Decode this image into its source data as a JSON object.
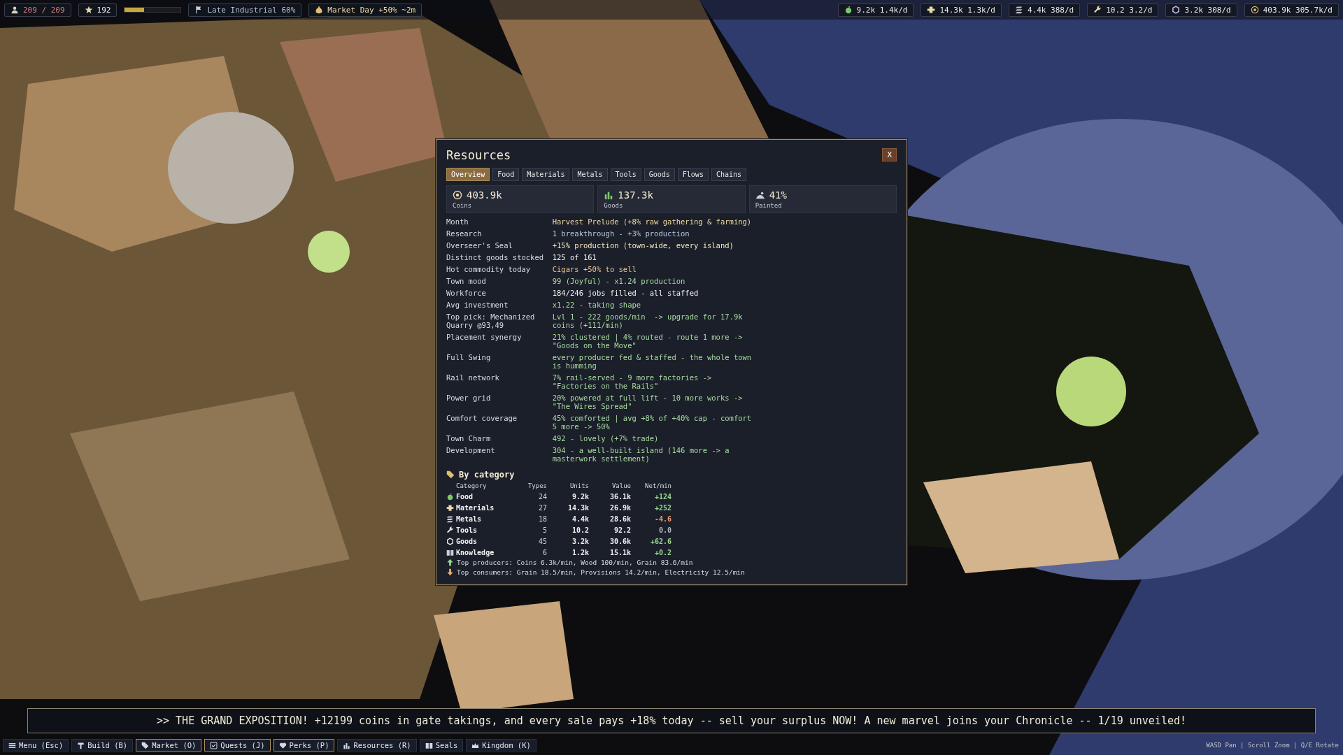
{
  "top_bar": {
    "population": "209 / 209",
    "stars": "192",
    "era_progress": {
      "level": 0.35
    },
    "era": "Late Industrial 60%",
    "event": "Market Day +50% ~2m",
    "resources": [
      {
        "text": "9.2k 1.4k/d"
      },
      {
        "text": "14.3k 1.3k/d"
      },
      {
        "text": "4.4k 388/d"
      },
      {
        "text": "10.2 3.2/d"
      },
      {
        "text": "3.2k 308/d"
      },
      {
        "text": "403.9k 305.7k/d"
      }
    ]
  },
  "panel": {
    "title": "Resources",
    "close": "X",
    "tabs": [
      {
        "label": "Overview",
        "selected": true
      },
      {
        "label": "Food",
        "selected": false
      },
      {
        "label": "Materials",
        "selected": false
      },
      {
        "label": "Metals",
        "selected": false
      },
      {
        "label": "Tools",
        "selected": false
      },
      {
        "label": "Goods",
        "selected": false
      },
      {
        "label": "Flows",
        "selected": false
      },
      {
        "label": "Chains",
        "selected": false
      }
    ],
    "stats": [
      {
        "value": "403.9k",
        "label": "Coins"
      },
      {
        "value": "137.3k",
        "label": "Goods"
      },
      {
        "value": "41%",
        "label": "Painted"
      }
    ],
    "rows": [
      {
        "label": "Month",
        "value": "Harvest Prelude (+8% raw gathering & farming)",
        "color": "#f0dca0"
      },
      {
        "label": "Research",
        "value": "1 breakthrough - +3% production",
        "color": "#b8c8e0"
      },
      {
        "label": "Overseer's Seal",
        "value": "+15% production (town-wide, every island)",
        "color": "#f4e6c0"
      },
      {
        "label": "Distinct goods stocked",
        "value": "125 of 161",
        "color": "#f4f4f4"
      },
      {
        "label": "Hot commodity today",
        "value": "Cigars +50% to sell",
        "color": "#e8c890"
      },
      {
        "label": "Town mood",
        "value": "99 (Joyful) - x1.24 production",
        "color": "#a8dca0"
      },
      {
        "label": "Workforce",
        "value": "184/246 jobs filled - all staffed",
        "color": "#f4f4f4"
      },
      {
        "label": "Avg investment",
        "value": "x1.22 - taking shape",
        "color": "#a8dca0"
      },
      {
        "label": "Top pick: Mechanized Quarry @93,49",
        "value": "Lvl 1 - 222 goods/min  -> upgrade for 17.9k coins (+111/min)",
        "color": "#a8dca0"
      },
      {
        "label": "Placement synergy",
        "value": "21% clustered | 4% routed - route 1 more -> \"Goods on the Move\"",
        "color": "#a8dca0"
      },
      {
        "label": "Full Swing",
        "value": "every producer fed & staffed - the whole town is humming",
        "color": "#a8dca0"
      },
      {
        "label": "Rail network",
        "value": "7% rail-served - 9 more factories -> \"Factories on the Rails\"",
        "color": "#a8dca0"
      },
      {
        "label": "Power grid",
        "value": "20% powered at full lift - 10 more works -> \"The Wires Spread\"",
        "color": "#a8dca0"
      },
      {
        "label": "Comfort coverage",
        "value": "45% comforted | avg +8% of +40% cap - comfort 5 more -> 50%",
        "color": "#a8dca0"
      },
      {
        "label": "Town Charm",
        "value": "492 - lovely (+7% trade)",
        "color": "#a8dca0"
      },
      {
        "label": "Development",
        "value": "304 - a well-built island (146 more -> a masterwork settlement)",
        "color": "#a8dca0"
      }
    ],
    "category_title": "By category",
    "columns": [
      "Category",
      "Types",
      "Units",
      "Value",
      "Net/min"
    ],
    "categories": [
      {
        "name": "Food",
        "types": "24",
        "units": "9.2k",
        "value": "36.1k",
        "net": "+124",
        "color": "#98d890"
      },
      {
        "name": "Materials",
        "types": "27",
        "units": "14.3k",
        "value": "26.9k",
        "net": "+252",
        "color": "#98d890"
      },
      {
        "name": "Metals",
        "types": "18",
        "units": "4.4k",
        "value": "28.6k",
        "net": "-4.6",
        "color": "#e8a070"
      },
      {
        "name": "Tools",
        "types": "5",
        "units": "10.2",
        "value": "92.2",
        "net": "0.0",
        "color": "#b0b4bc"
      },
      {
        "name": "Goods",
        "types": "45",
        "units": "3.2k",
        "value": "30.6k",
        "net": "+62.6",
        "color": "#98d890"
      },
      {
        "name": "Knowledge",
        "types": "6",
        "units": "1.2k",
        "value": "15.1k",
        "net": "+0.2",
        "color": "#98d890"
      }
    ],
    "producers": "Top producers: Coins 6.3k/min, Wood 100/min, Grain 83.6/min",
    "consumers": "Top consumers: Grain 18.5/min, Provisions 14.2/min, Electricity 12.5/min"
  },
  "ticker": ">> THE GRAND EXPOSITION! +12199 coins in gate takings, and every sale pays +18% today -- sell your surplus NOW! A new marvel joins your Chronicle -- 1/19 unveiled!",
  "bottom_bar": {
    "buttons": [
      {
        "label": "Menu (Esc)",
        "highlighted": false
      },
      {
        "label": "Build (B)",
        "highlighted": false
      },
      {
        "label": "Market (O)",
        "highlighted": true
      },
      {
        "label": "Quests (J)",
        "highlighted": true
      },
      {
        "label": "Perks (P)",
        "highlighted": true
      },
      {
        "label": "Resources (R)",
        "highlighted": false
      },
      {
        "label": "Seals",
        "highlighted": false
      },
      {
        "label": "Kingdom (K)",
        "highlighted": false
      }
    ],
    "hints": "WASD Pan | Scroll Zoom | Q/E Rotate"
  }
}
